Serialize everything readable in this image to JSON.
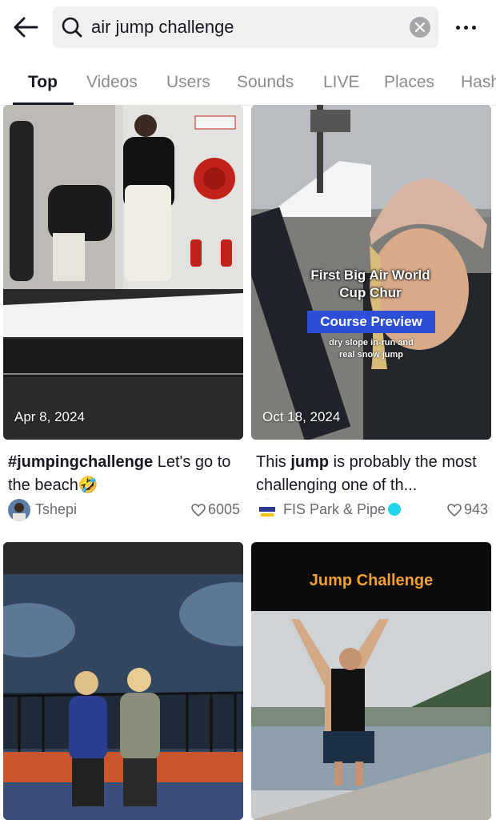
{
  "search": {
    "query": "air jump challenge"
  },
  "tabs": [
    {
      "label": "Top"
    },
    {
      "label": "Videos"
    },
    {
      "label": "Users"
    },
    {
      "label": "Sounds"
    },
    {
      "label": "LIVE"
    },
    {
      "label": "Places"
    },
    {
      "label": "Hashtags"
    }
  ],
  "results": [
    {
      "date": "Apr 8, 2024",
      "caption_bold": "#jumpingchallenge",
      "caption_rest": " Let's go to the beach🤣",
      "author": "Tshepi",
      "likes": "6005"
    },
    {
      "date": "Oct 18, 2024",
      "overlay_title": "First Big Air World Cup Chur",
      "overlay_badge": "Course Preview",
      "overlay_sub": "dry slope in-run and real snow jump",
      "caption_pre": "This ",
      "caption_bold": "jump",
      "caption_rest": " is probably the most challenging one of th...",
      "author": "FIS Park & Pipe",
      "likes": "943"
    },
    {
      "date": "",
      "author": "",
      "likes": ""
    },
    {
      "banner": "Jump Challenge"
    }
  ],
  "colors": {
    "accent_verified": "#20d5ec",
    "badge_blue": "#2d4fd8",
    "banner_orange": "#f5a031"
  }
}
